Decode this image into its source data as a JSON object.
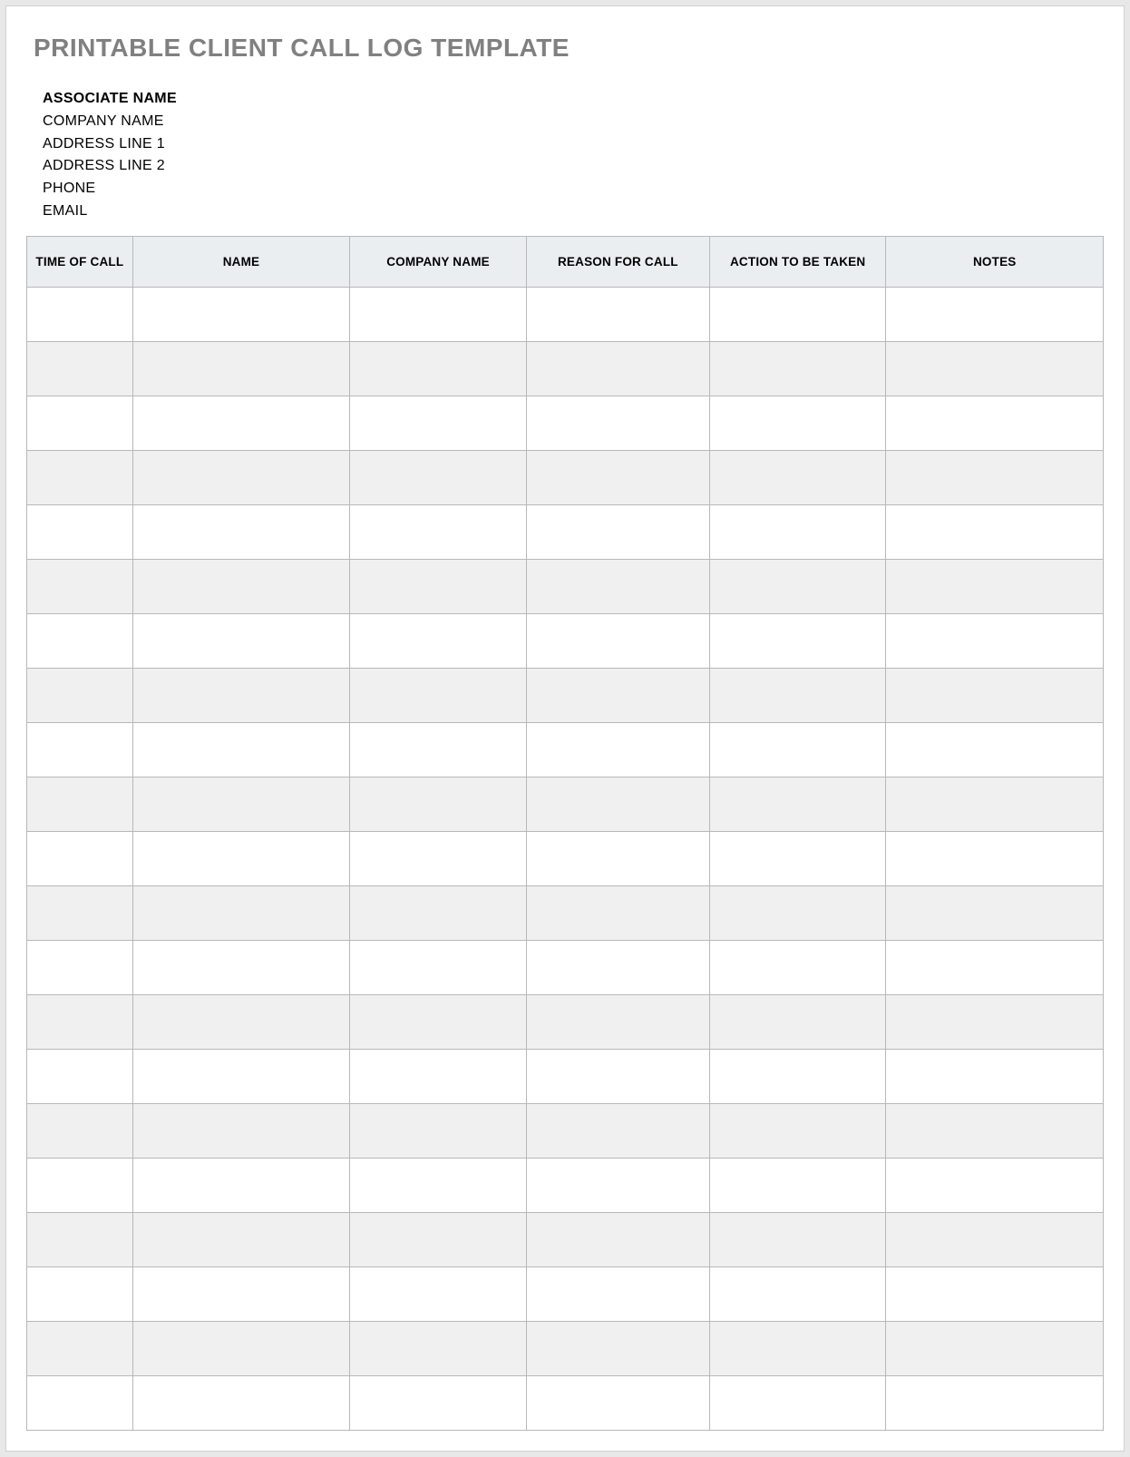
{
  "title": "PRINTABLE CLIENT CALL LOG TEMPLATE",
  "info": {
    "associate_label": "ASSOCIATE NAME",
    "company_label": "COMPANY NAME",
    "address1_label": "ADDRESS LINE 1",
    "address2_label": "ADDRESS LINE 2",
    "phone_label": "PHONE",
    "email_label": "EMAIL"
  },
  "columns": {
    "time": "TIME OF CALL",
    "name": "NAME",
    "company": "COMPANY NAME",
    "reason": "REASON FOR CALL",
    "action": "ACTION TO BE TAKEN",
    "notes": "NOTES"
  },
  "rows": [
    {
      "time": "",
      "name": "",
      "company": "",
      "reason": "",
      "action": "",
      "notes": ""
    },
    {
      "time": "",
      "name": "",
      "company": "",
      "reason": "",
      "action": "",
      "notes": ""
    },
    {
      "time": "",
      "name": "",
      "company": "",
      "reason": "",
      "action": "",
      "notes": ""
    },
    {
      "time": "",
      "name": "",
      "company": "",
      "reason": "",
      "action": "",
      "notes": ""
    },
    {
      "time": "",
      "name": "",
      "company": "",
      "reason": "",
      "action": "",
      "notes": ""
    },
    {
      "time": "",
      "name": "",
      "company": "",
      "reason": "",
      "action": "",
      "notes": ""
    },
    {
      "time": "",
      "name": "",
      "company": "",
      "reason": "",
      "action": "",
      "notes": ""
    },
    {
      "time": "",
      "name": "",
      "company": "",
      "reason": "",
      "action": "",
      "notes": ""
    },
    {
      "time": "",
      "name": "",
      "company": "",
      "reason": "",
      "action": "",
      "notes": ""
    },
    {
      "time": "",
      "name": "",
      "company": "",
      "reason": "",
      "action": "",
      "notes": ""
    },
    {
      "time": "",
      "name": "",
      "company": "",
      "reason": "",
      "action": "",
      "notes": ""
    },
    {
      "time": "",
      "name": "",
      "company": "",
      "reason": "",
      "action": "",
      "notes": ""
    },
    {
      "time": "",
      "name": "",
      "company": "",
      "reason": "",
      "action": "",
      "notes": ""
    },
    {
      "time": "",
      "name": "",
      "company": "",
      "reason": "",
      "action": "",
      "notes": ""
    },
    {
      "time": "",
      "name": "",
      "company": "",
      "reason": "",
      "action": "",
      "notes": ""
    },
    {
      "time": "",
      "name": "",
      "company": "",
      "reason": "",
      "action": "",
      "notes": ""
    },
    {
      "time": "",
      "name": "",
      "company": "",
      "reason": "",
      "action": "",
      "notes": ""
    },
    {
      "time": "",
      "name": "",
      "company": "",
      "reason": "",
      "action": "",
      "notes": ""
    },
    {
      "time": "",
      "name": "",
      "company": "",
      "reason": "",
      "action": "",
      "notes": ""
    },
    {
      "time": "",
      "name": "",
      "company": "",
      "reason": "",
      "action": "",
      "notes": ""
    },
    {
      "time": "",
      "name": "",
      "company": "",
      "reason": "",
      "action": "",
      "notes": ""
    }
  ]
}
